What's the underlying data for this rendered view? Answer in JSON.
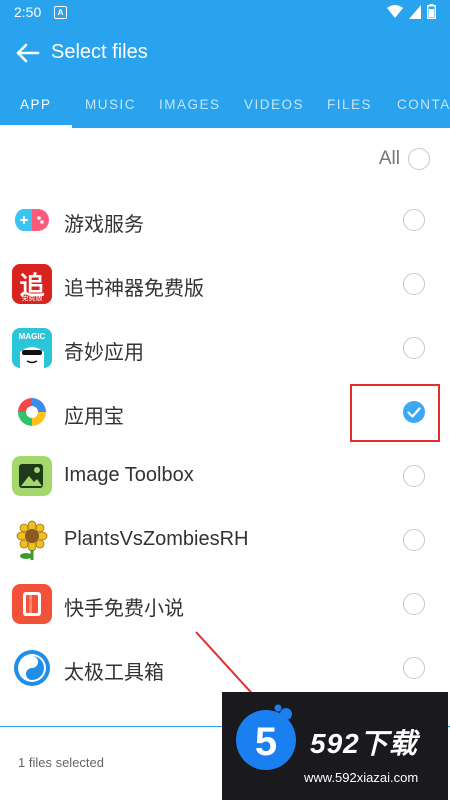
{
  "status_bar": {
    "time": "2:50",
    "notif_letter": "A"
  },
  "toolbar": {
    "title": "Select files"
  },
  "tabs": [
    {
      "label": "APP",
      "active": true
    },
    {
      "label": "MUSIC",
      "active": false
    },
    {
      "label": "IMAGES",
      "active": false
    },
    {
      "label": "VIDEOS",
      "active": false
    },
    {
      "label": "FILES",
      "active": false
    },
    {
      "label": "CONTA",
      "active": false
    }
  ],
  "select_all": {
    "label": "All",
    "checked": false
  },
  "apps": [
    {
      "name": "游戏服务",
      "icon": "game-service-icon",
      "checked": false
    },
    {
      "name": "追书神器免费版",
      "icon": "zhuishu-icon",
      "checked": false
    },
    {
      "name": "奇妙应用",
      "icon": "magic-app-icon",
      "checked": false
    },
    {
      "name": "应用宝",
      "icon": "yingyongbao-icon",
      "checked": true
    },
    {
      "name": "Image Toolbox",
      "icon": "image-toolbox-icon",
      "checked": false
    },
    {
      "name": "PlantsVsZombiesRH",
      "icon": "pvz-icon",
      "checked": false
    },
    {
      "name": "快手免费小说",
      "icon": "kuaishou-novel-icon",
      "checked": false
    },
    {
      "name": "太极工具箱",
      "icon": "taiji-icon",
      "checked": false
    }
  ],
  "bottom_bar": {
    "selected_count": "1 files selected"
  },
  "watermark": {
    "logo_digit": "5",
    "brand": "592下载",
    "url": "www.592xiazai.com"
  },
  "icons": {
    "zhuishu_char": "追",
    "zhuishu_sub": "免费版",
    "magic_text": "MAGIC"
  },
  "colors": {
    "primary": "#2aa3ee",
    "checked": "#3aa9f1",
    "highlight": "#e0312b"
  }
}
